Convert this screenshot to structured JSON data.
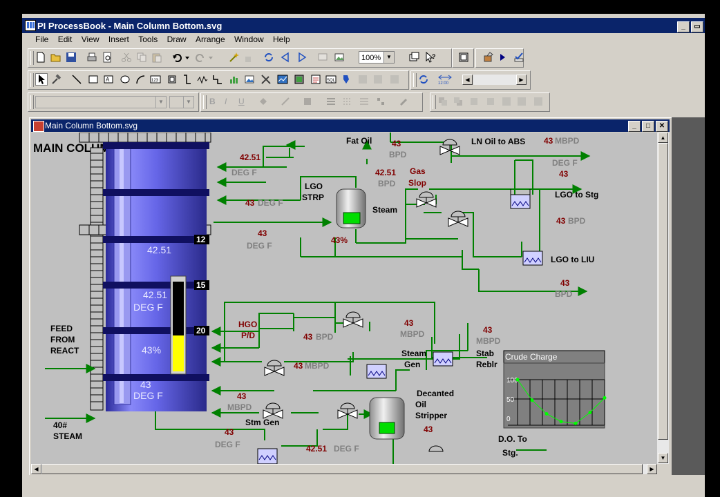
{
  "window": {
    "title": "PI ProcessBook - Main Column Bottom.svg"
  },
  "menu": [
    "File",
    "Edit",
    "View",
    "Insert",
    "Tools",
    "Draw",
    "Arrange",
    "Window",
    "Help"
  ],
  "toolbar": {
    "zoom": "100%"
  },
  "child": {
    "title": "Main Column Bottom.svg"
  },
  "diagram": {
    "title": "MAIN COLUMN BOTTOM",
    "tray_numbers": [
      "12",
      "15",
      "20"
    ],
    "column": {
      "temp1": "42.51",
      "temp2": "42.51",
      "temp2_unit": "DEG F",
      "level": "43%",
      "level_fraction": 0.4,
      "temp3": "43",
      "temp3_unit": "DEG F"
    },
    "labels": {
      "fat_oil": "Fat Oil",
      "ln_oil": "LN Oil to ABS",
      "gas_slop_1": "Gas",
      "gas_slop_2": "Slop",
      "lgo_strp_1": "LGO",
      "lgo_strp_2": "STRP",
      "steam": "Steam",
      "lgo_stg": "LGO to Stg",
      "lgo_liu": "LGO to LIU",
      "feed_1": "FEED",
      "feed_2": "FROM",
      "feed_3": "REACT",
      "steam40_1": "40#",
      "steam40_2": "STEAM",
      "hgo_1": "HGO",
      "hgo_2": "P/D",
      "steam_gen_1": "Steam",
      "steam_gen_2": "Gen",
      "stab_1": "Stab",
      "stab_2": "Reblr",
      "stm_gen": "Stm Gen",
      "decanted_1": "Decanted",
      "decanted_2": "Oil",
      "decanted_3": "Stripper",
      "do_1": "D.O. To",
      "do_2": "Stg."
    },
    "values": {
      "v_4251_a": "42.51",
      "u_degf_a": "DEG F",
      "v_43_degf_b": "43",
      "u_degf_b": "DEG F",
      "v_43_bpd_fat": "43",
      "u_bpd_fat": "BPD",
      "v_4251_bpd": "42.51",
      "u_bpd_b": "BPD",
      "v_43_mbpd_ln": "43",
      "u_mbpd_ln": "MBPD",
      "u_degf_ln": "DEG F",
      "v_43_ln2": "43",
      "v_43_bpd_lgo": "43",
      "u_bpd_lgo": "BPD",
      "v_43_degf_c": "43",
      "u_degf_c": "DEG F",
      "v_43_bpd_liu": "43",
      "u_bpd_liu": "BPD",
      "lgo_strp_level": "43%",
      "v_43_bpd_hgo": "43",
      "u_bpd_hgo": "BPD",
      "v_43_mbpd_sg": "43",
      "u_mbpd_sg": "MBPD",
      "v_43_mbpd_stab": "43",
      "u_mbpd_stab": "MBPD",
      "v_43_mbpd_mid": "43",
      "u_mbpd_mid": "MBPD",
      "v_43_mbpd_stm": "43",
      "u_mbpd_stm": "MBPD",
      "v_43_degf_bot": "43",
      "u_degf_bot": "DEG F",
      "v_4251_bot": "42.51",
      "u_degf_bot2": "DEG F",
      "v_43_decanted": "43"
    },
    "trend": {
      "title": "Crude Charge",
      "ticks": [
        "100",
        "50",
        "0"
      ]
    }
  },
  "chart_data": {
    "type": "line",
    "title": "Crude Charge",
    "ylim": [
      0,
      100
    ],
    "series": [
      {
        "values": [
          100,
          55,
          25,
          8,
          4,
          28,
          60
        ]
      }
    ]
  },
  "colors": {
    "pipe": "#008000",
    "value": "#800000",
    "unit": "#808080",
    "titlebar": "#0a246a"
  }
}
